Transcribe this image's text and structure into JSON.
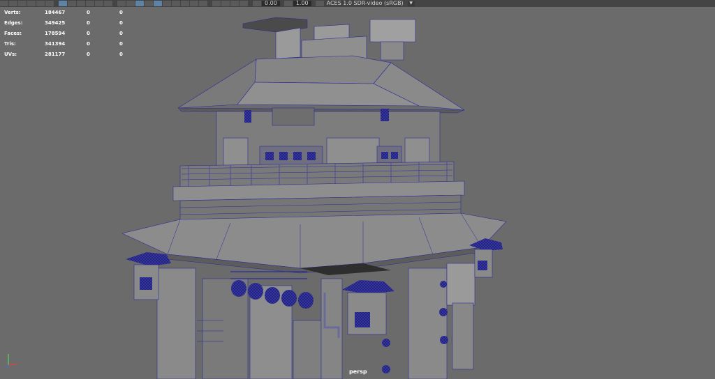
{
  "toolbar": {
    "exposure_value": "0.00",
    "gamma_value": "1.00",
    "color_space": "ACES 1.0 SDR-video (sRGB)"
  },
  "hud": {
    "rows": [
      {
        "label": "Verts:",
        "total": "184467",
        "selected": "0",
        "uv": "0"
      },
      {
        "label": "Edges:",
        "total": "349425",
        "selected": "0",
        "uv": "0"
      },
      {
        "label": "Faces:",
        "total": "178594",
        "selected": "0",
        "uv": "0"
      },
      {
        "label": "Tris:",
        "total": "341394",
        "selected": "0",
        "uv": "0"
      },
      {
        "label": "UVs:",
        "total": "281177",
        "selected": "0",
        "uv": "0"
      }
    ]
  },
  "viewport": {
    "camera_label": "persp"
  },
  "colors": {
    "viewport_bg": "#6b6b6b",
    "toolbar_bg": "#444444",
    "wireframe": "#2a2a9a",
    "mesh_gray": "#8a8a8a",
    "selection_blue": "#5d84a6"
  }
}
